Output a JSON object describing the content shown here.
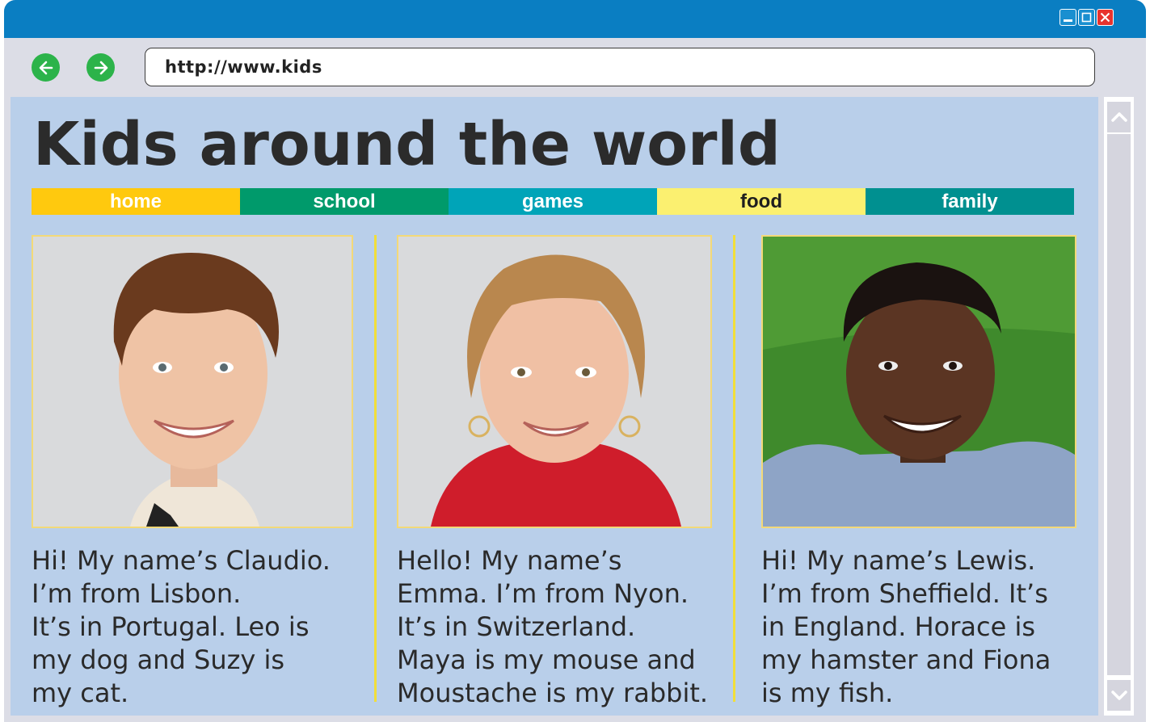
{
  "browser": {
    "address": "http://www.kids",
    "icons": {
      "back": "arrow-left-icon",
      "forward": "arrow-right-icon",
      "minimize": "minimize-icon",
      "maximize": "maximize-icon",
      "close": "close-icon",
      "scroll_up": "chevron-up-icon",
      "scroll_down": "chevron-down-icon"
    },
    "colors": {
      "titlebar": "#0a7ec2",
      "nav_button": "#2cb34a",
      "close_button": "#e8332e",
      "page_background": "#b9cfea"
    }
  },
  "page": {
    "title": "Kids around the world",
    "menu": [
      {
        "label": "home",
        "bg": "#ffc90e",
        "fg": "#ffffff"
      },
      {
        "label": "school",
        "bg": "#009a6b",
        "fg": "#ffffff"
      },
      {
        "label": "games",
        "bg": "#00a4b8",
        "fg": "#ffffff"
      },
      {
        "label": "food",
        "bg": "#fbf070",
        "fg": "#1e1e1e"
      },
      {
        "label": "family",
        "bg": "#009090",
        "fg": "#ffffff"
      }
    ],
    "kids": [
      {
        "name": "Claudio",
        "text": "Hi! My name’s Claudio.\nI’m from Lisbon.\nIt’s in Portugal. Leo is\nmy dog and Suzy is\nmy cat."
      },
      {
        "name": "Emma",
        "text": "Hello! My name’s\nEmma. I’m from Nyon.\nIt’s in Switzerland.\nMaya is my mouse and\nMoustache is my rabbit."
      },
      {
        "name": "Lewis",
        "text": "Hi! My name’s Lewis.\nI’m from Sheffield. It’s\nin England. Horace is\nmy hamster and Fiona\nis my fish."
      }
    ]
  }
}
